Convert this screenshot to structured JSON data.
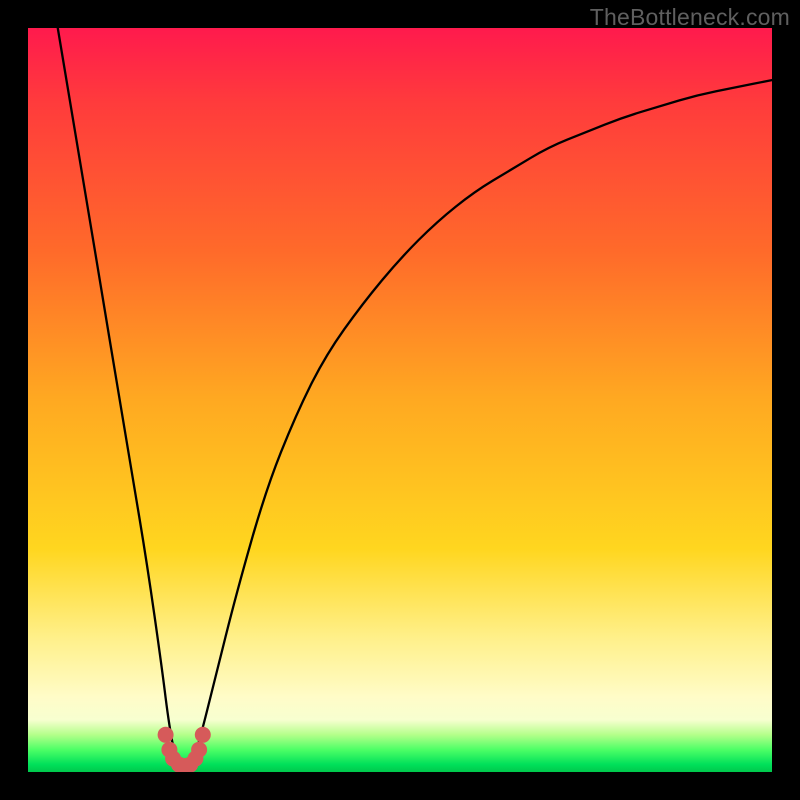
{
  "watermark": "TheBottleneck.com",
  "chart_data": {
    "type": "line",
    "title": "",
    "xlabel": "",
    "ylabel": "",
    "xlim": [
      0,
      100
    ],
    "ylim": [
      0,
      100
    ],
    "grid": false,
    "legend": false,
    "series": [
      {
        "name": "bottleneck-curve",
        "x": [
          4,
          6,
          8,
          10,
          12,
          14,
          16,
          18,
          19,
          20,
          21,
          22,
          23,
          25,
          28,
          32,
          36,
          40,
          45,
          50,
          55,
          60,
          65,
          70,
          75,
          80,
          85,
          90,
          95,
          100
        ],
        "values": [
          100,
          88,
          76,
          64,
          52,
          40,
          28,
          14,
          6,
          1,
          0,
          1,
          4,
          12,
          24,
          38,
          48,
          56,
          63,
          69,
          74,
          78,
          81,
          84,
          86,
          88,
          89.5,
          91,
          92,
          93
        ],
        "note": "values are percentage height above bottom (0 = bottom green band, 100 = top). Minimum near x≈21 corresponds to optimal match (no bottleneck)."
      },
      {
        "name": "marker-dots",
        "x": [
          18.5,
          19.0,
          19.5,
          20.3,
          21.0,
          21.8,
          22.5,
          23.0,
          23.5
        ],
        "values": [
          5.0,
          3.0,
          1.8,
          1.0,
          0.8,
          1.0,
          1.8,
          3.0,
          5.0
        ],
        "note": "red dots clustered at the base of the V-notch, same coordinate convention as above"
      }
    ],
    "gradient_colors_top_to_bottom": [
      "#ff1a4d",
      "#ff6a2a",
      "#ffd61f",
      "#fffcc8",
      "#00c84c"
    ]
  }
}
